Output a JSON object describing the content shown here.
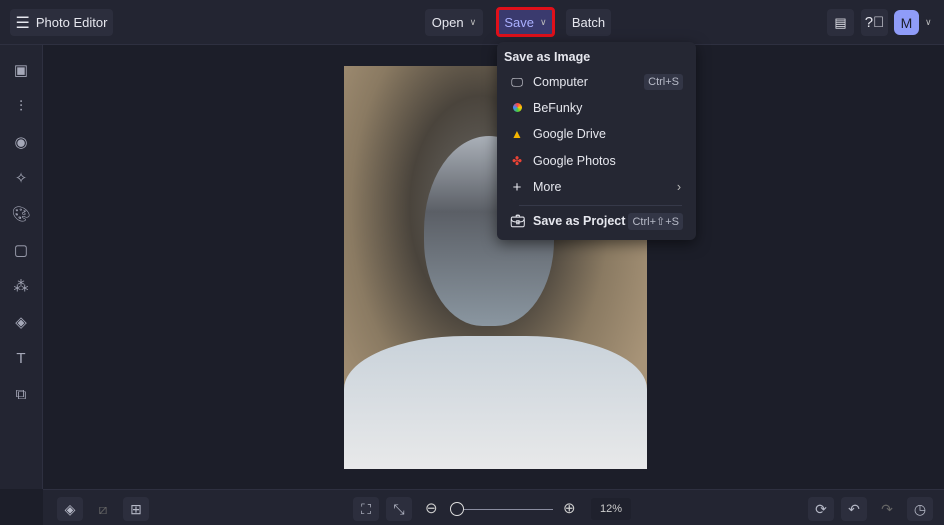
{
  "header": {
    "title": "Photo Editor",
    "open": "Open",
    "save": "Save",
    "batch": "Batch",
    "avatar": "M"
  },
  "save_menu": {
    "heading": "Save as Image",
    "items": [
      {
        "label": "Computer",
        "shortcut": "Ctrl+S"
      },
      {
        "label": "BeFunky"
      },
      {
        "label": "Google Drive"
      },
      {
        "label": "Google Photos"
      },
      {
        "label": "More"
      }
    ],
    "project": {
      "label": "Save as Project",
      "shortcut": "Ctrl+⇧+S"
    }
  },
  "bottom": {
    "zoom_label": "12%",
    "zoom_slider_fraction": 0.0
  },
  "colors": {
    "highlight": "#e0101a",
    "avatar": "#8f9cf8",
    "save_bg": "#3a3a6e"
  }
}
